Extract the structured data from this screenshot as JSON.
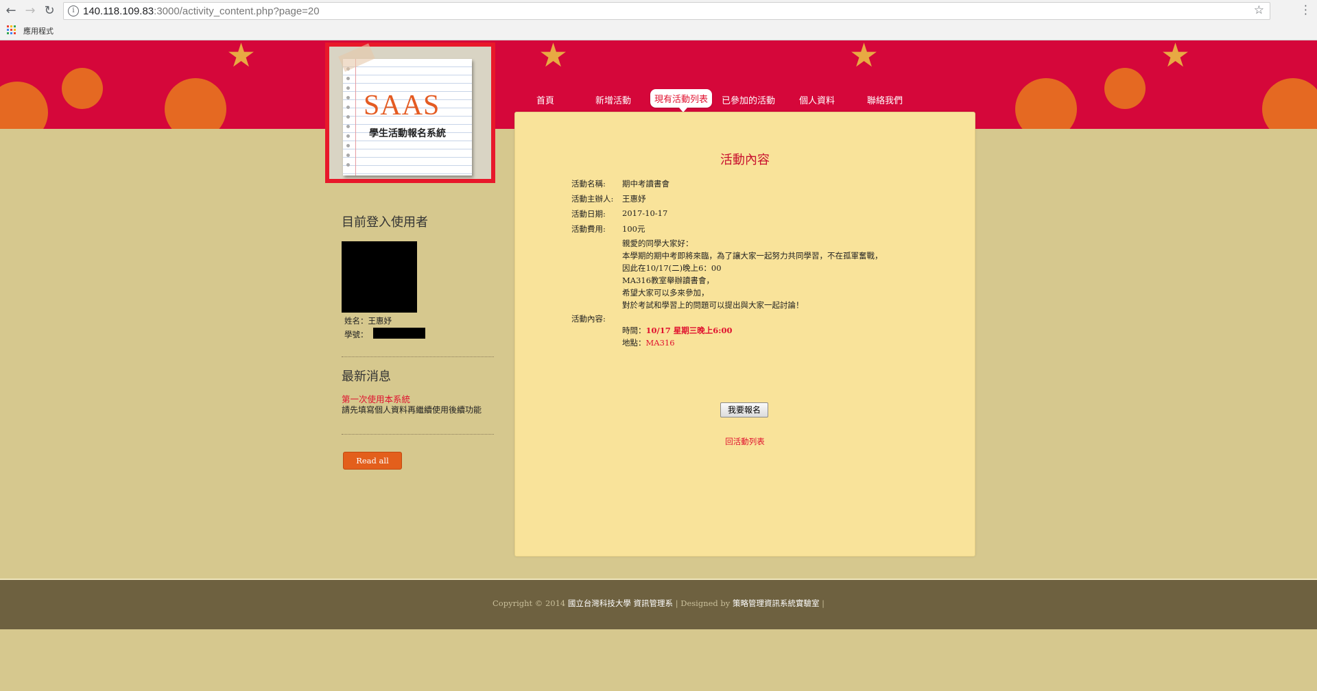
{
  "browser": {
    "url_host": "140.118.109.83",
    "url_path": ":3000/activity_content.php?page=20",
    "apps_label": "應用程式"
  },
  "logo": {
    "title": "SAAS",
    "subtitle": "學生活動報名系統"
  },
  "nav": {
    "items": [
      "首頁",
      "新增活動",
      "現有活動列表",
      "已參加的活動",
      "個人資料",
      "聯絡我們"
    ],
    "active_index": 2
  },
  "main": {
    "title": "活動內容",
    "fields": [
      {
        "label": "活動名稱:",
        "value": "期中考讀書會"
      },
      {
        "label": "活動主辦人:",
        "value": "王惠妤"
      },
      {
        "label": "活動日期:",
        "value": "2017-10-17"
      },
      {
        "label": "活動費用:",
        "value": "100元"
      }
    ],
    "description_lines": [
      "親愛的同學大家好：",
      "本學期的期中考即將來臨，為了讓大家一起努力共同學習，不在孤軍奮戰，",
      "因此在10/17(二)晚上6：00",
      "MA316教室舉辦讀書會，",
      "希望大家可以多來參加，",
      "對於考試和學習上的問題可以提出與大家一起討論！"
    ],
    "content_label": "活動內容:",
    "time_label": "時間：",
    "time_value": "10/17 星期三晚上6:00",
    "place_label": "地點：",
    "place_value": "MA316",
    "signup_button": "我要報名",
    "back_link": "回活動列表"
  },
  "sidebar": {
    "user_heading": "目前登入使用者",
    "name_label": "姓名：",
    "name_value": "王惠妤",
    "id_label": "學號：",
    "news_heading": "最新消息",
    "news_title": "第一次使用本系統",
    "news_body": "請先填寫個人資料再繼續使用後續功能",
    "read_all": "Read all"
  },
  "footer": {
    "prefix": "Copyright © 2014",
    "org1": "國立台灣科技大學 資訊管理系",
    "middle": "| Designed by",
    "org2": "策略管理資訊系統實驗室",
    "suffix": "|"
  },
  "colors": {
    "banner_red": "#d5073a",
    "accent_red": "#e0102e",
    "panel_yellow": "#f9e39a",
    "page_tan": "#d6c88e",
    "footer_brown": "#6e6140",
    "button_orange": "#e35f1c"
  }
}
